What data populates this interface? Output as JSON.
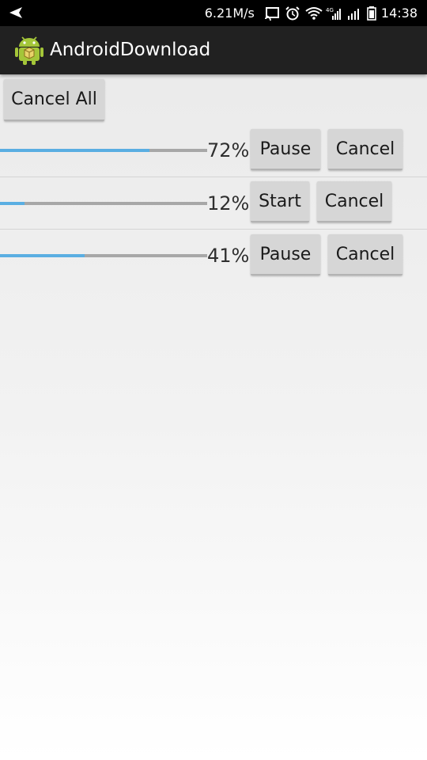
{
  "status_bar": {
    "net_speed": "6.21M/s",
    "time": "14:38"
  },
  "app": {
    "title": "AndroidDownload"
  },
  "actions": {
    "cancel_all_label": "Cancel All"
  },
  "downloads": [
    {
      "progress": 72,
      "percent_label": "72%",
      "toggle_label": "Pause",
      "cancel_label": "Cancel"
    },
    {
      "progress": 12,
      "percent_label": "12%",
      "toggle_label": "Start",
      "cancel_label": "Cancel"
    },
    {
      "progress": 41,
      "percent_label": "41%",
      "toggle_label": "Pause",
      "cancel_label": "Cancel"
    }
  ],
  "colors": {
    "progress_fill": "#5aaee2",
    "progress_track": "#a7a7a7",
    "button_bg": "#d6d6d6",
    "action_bar": "#212121"
  }
}
